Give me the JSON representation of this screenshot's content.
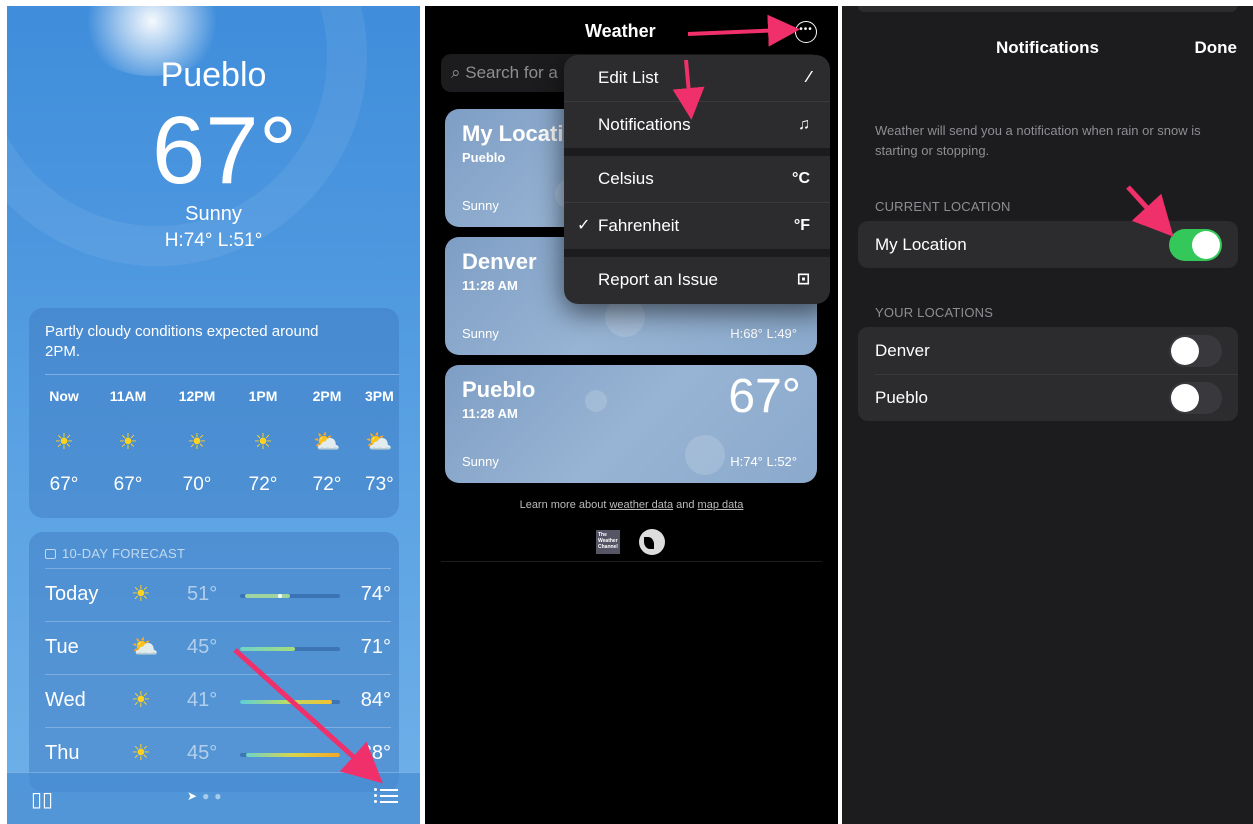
{
  "panel1": {
    "city": "Pueblo",
    "temp": "67°",
    "condition": "Sunny",
    "high_low": "H:74°  L:51°",
    "hourly_summary": "Partly cloudy conditions expected around 2PM.",
    "hours": [
      {
        "time": "Now",
        "icon": "☀",
        "temp": "67°"
      },
      {
        "time": "11AM",
        "icon": "☀",
        "temp": "67°"
      },
      {
        "time": "12PM",
        "icon": "☀",
        "temp": "70°"
      },
      {
        "time": "1PM",
        "icon": "☀",
        "temp": "72°"
      },
      {
        "time": "2PM",
        "icon": "⛅",
        "temp": "72°"
      },
      {
        "time": "3PM",
        "icon": "⛅",
        "temp": "73°"
      }
    ],
    "forecast_header": "10-DAY FORECAST",
    "days": [
      {
        "day": "Today",
        "icon": "☀",
        "low": "51°",
        "high": "74°"
      },
      {
        "day": "Tue",
        "icon": "⛅",
        "low": "45°",
        "high": "71°"
      },
      {
        "day": "Wed",
        "icon": "☀",
        "low": "41°",
        "high": "84°"
      },
      {
        "day": "Thu",
        "icon": "☀",
        "low": "45°",
        "high": "88°"
      }
    ]
  },
  "panel2": {
    "title": "Weather",
    "search_placeholder": "Search for a",
    "locations": [
      {
        "name": "My Locati",
        "sub": "Pueblo",
        "condition": "Sunny",
        "high_low": ""
      },
      {
        "name": "Denver",
        "sub": "11:28 AM",
        "condition": "Sunny",
        "high_low": "H:68°  L:49°"
      },
      {
        "name": "Pueblo",
        "sub": "11:28 AM",
        "condition": "Sunny",
        "high_low": "H:74°  L:52°",
        "temp": "67°"
      }
    ],
    "menu": {
      "edit_list": "Edit List",
      "notifications": "Notifications",
      "celsius": "Celsius",
      "celsius_unit": "°C",
      "fahrenheit": "Fahrenheit",
      "fahrenheit_unit": "°F",
      "checkmark": "✓",
      "report": "Report an Issue"
    },
    "learn_prefix": "Learn more about ",
    "learn_link1": "weather data",
    "learn_mid": " and ",
    "learn_link2": "map data",
    "twc_logo": [
      "The",
      "Weather",
      "Channel"
    ]
  },
  "panel3": {
    "title": "Notifications",
    "done": "Done",
    "description": "Weather will send you a notification when rain or snow is starting or stopping.",
    "current_header": "CURRENT LOCATION",
    "current_row": "My Location",
    "your_header": "YOUR LOCATIONS",
    "your_rows": [
      "Denver",
      "Pueblo"
    ]
  },
  "colors": {
    "toggle_on": "#34c759",
    "toggle_off": "#39393d",
    "arrow": "#f0306a",
    "sun": "#ffd21f"
  }
}
